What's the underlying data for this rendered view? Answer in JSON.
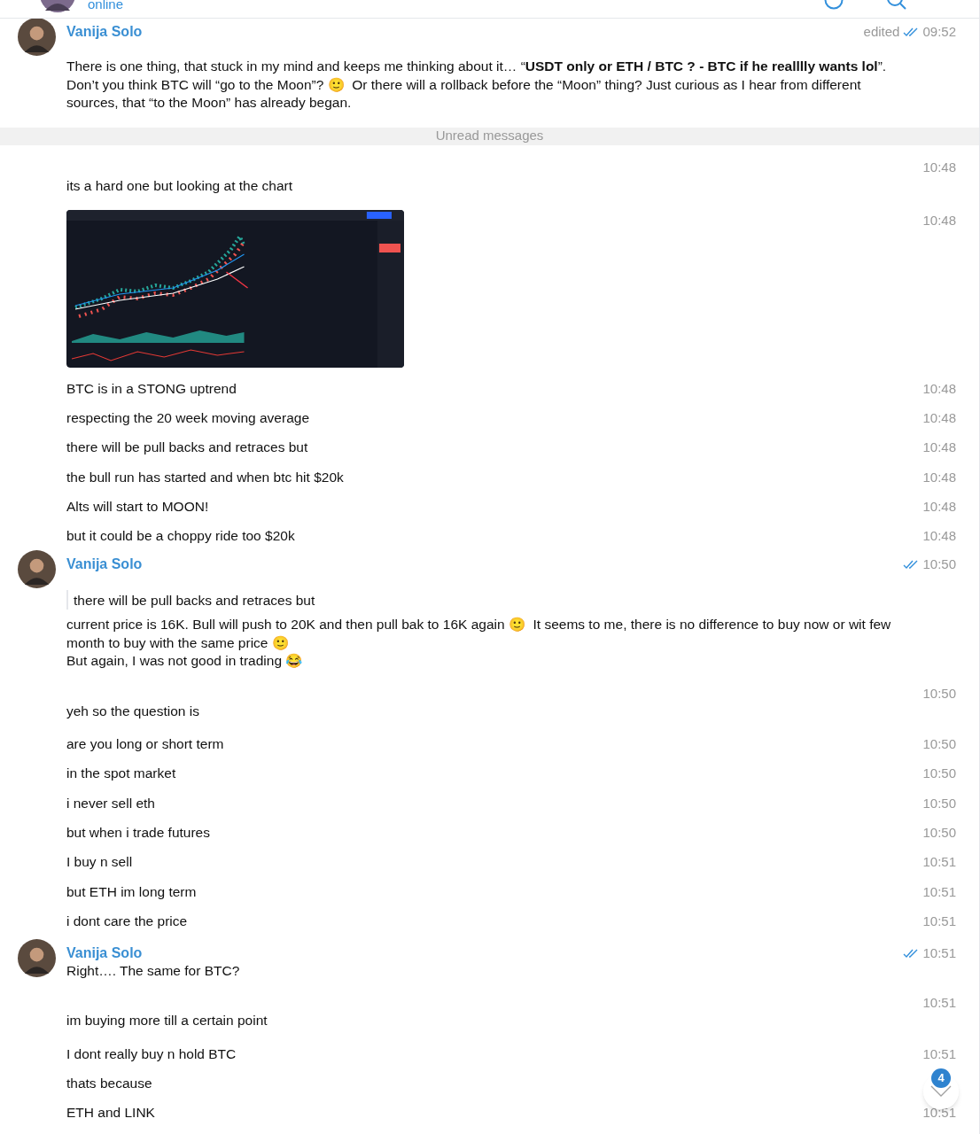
{
  "header": {
    "status": "online"
  },
  "messages": [
    {
      "kind": "post",
      "author": "Vanija Solo",
      "edited": "edited",
      "read": true,
      "time": "09:52",
      "text": "There is one thing, that stuck in my mind and keeps me thinking about it… “**USDT only or ETH / BTC ? - BTC if he realllly wants lol**”. Don’t you think BTC will “go to the Moon”? 🙂  Or there will a rollback before the “Moon” thing? Just curious as I hear from different sources, that “to the Moon” has already began."
    },
    {
      "kind": "divider",
      "text": "Unread messages"
    },
    {
      "kind": "group_first",
      "time": "10:48",
      "text": "its a hard one but looking at the chart"
    },
    {
      "time": "10:48"
    },
    {
      "kind": "text",
      "time": "10:48",
      "text": "BTC is in a STONG uptrend"
    },
    {
      "kind": "text",
      "time": "10:48",
      "text": "respecting the 20 week moving average"
    },
    {
      "kind": "text",
      "time": "10:48",
      "text": "there will be pull backs and retraces but"
    },
    {
      "kind": "text",
      "time": "10:48",
      "text": "the bull run has started and when btc hit $20k"
    },
    {
      "kind": "text",
      "time": "10:48",
      "text": "Alts will start to MOON!"
    },
    {
      "kind": "text",
      "time": "10:48",
      "text": "but it could be a choppy ride too $20k"
    },
    {
      "kind": "post",
      "author": "Vanija Solo",
      "read": true,
      "time": "10:50",
      "quote": "there will be pull backs and retraces but",
      "text": "current price is 16K. Bull will push to 20K and then pull bak to 16K again 🙂  It seems to me, there is no difference to buy now or wit few month to buy with the same price 🙂\nBut again, I was not good in trading 😂"
    },
    {
      "kind": "group_first",
      "time": "10:50",
      "text": "yeh so the question is"
    },
    {
      "kind": "text",
      "time": "10:50",
      "text": "are you long or short term"
    },
    {
      "kind": "text",
      "time": "10:50",
      "text": "in the spot market"
    },
    {
      "kind": "text",
      "time": "10:50",
      "text": "i never sell eth"
    },
    {
      "kind": "text",
      "time": "10:50",
      "text": "but when i trade futures"
    },
    {
      "kind": "text",
      "time": "10:51",
      "text": "I buy n sell"
    },
    {
      "kind": "text",
      "time": "10:51",
      "text": "but ETH im long term"
    },
    {
      "kind": "text",
      "time": "10:51",
      "text": "i dont care the price"
    },
    {
      "kind": "short",
      "author": "Vanija Solo",
      "read": true,
      "time": "10:51",
      "text": "Right…. The same for BTC?"
    },
    {
      "kind": "group_first",
      "time": "10:51",
      "text": "im buying more till a certain point"
    },
    {
      "kind": "text",
      "time": "10:51",
      "text": "I dont really buy n hold BTC"
    },
    {
      "kind": "text",
      "text": "thats because"
    },
    {
      "kind": "text",
      "time": "10:51",
      "text": "ETH and LINK"
    }
  ],
  "scroll_button": {
    "badge": "4"
  }
}
